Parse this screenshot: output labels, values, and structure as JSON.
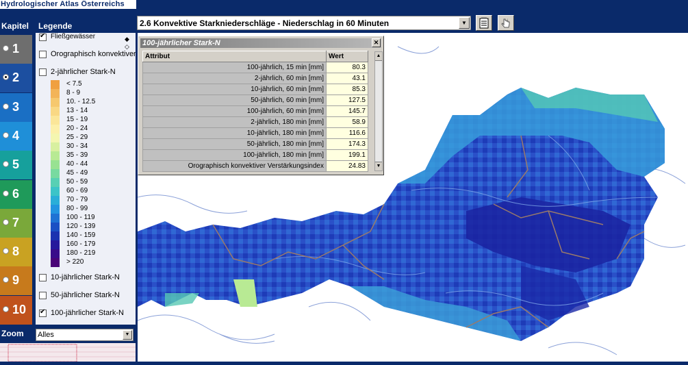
{
  "app": {
    "title": "Hydrologischer Atlas Österreichs"
  },
  "toolbar": {
    "map_select_value": "2.6 Konvektive Starkniederschläge - Niederschlag in 60 Minuten",
    "print_icon": "notepad-icon",
    "info_icon": "hand-pointer-icon"
  },
  "sidebar": {
    "kapitel_label": "Kapitel",
    "legende_label": "Legende",
    "chapters": [
      {
        "label": "1",
        "color": "#6e6e6e",
        "selected": false
      },
      {
        "label": "2",
        "color": "#1c4fa0",
        "selected": true
      },
      {
        "label": "3",
        "color": "#1a6fc4",
        "selected": false
      },
      {
        "label": "4",
        "color": "#1f8fd8",
        "selected": false
      },
      {
        "label": "5",
        "color": "#16a09c",
        "selected": false
      },
      {
        "label": "6",
        "color": "#1f9a5a",
        "selected": false
      },
      {
        "label": "7",
        "color": "#7aa83a",
        "selected": false
      },
      {
        "label": "8",
        "color": "#c9a222",
        "selected": false
      },
      {
        "label": "9",
        "color": "#c77a1c",
        "selected": false
      },
      {
        "label": "10",
        "color": "#c0521c",
        "selected": false
      }
    ]
  },
  "legend": {
    "layers": [
      {
        "label": "Fließgewässer",
        "checked": true
      },
      {
        "label": "Orographisch konvektiver",
        "checked": false
      },
      {
        "label": "2-jährlicher Stark-N",
        "checked": false
      }
    ],
    "classes": [
      {
        "label": "< 7.5",
        "color": "#f0a040"
      },
      {
        "label": "8 - 9",
        "color": "#f3b458"
      },
      {
        "label": "10. - 12.5",
        "color": "#f6c86e"
      },
      {
        "label": "13 - 14",
        "color": "#f9d884"
      },
      {
        "label": "15 - 19",
        "color": "#fbe699"
      },
      {
        "label": "20 - 24",
        "color": "#fcf0aa"
      },
      {
        "label": "25 - 29",
        "color": "#f4f6b0"
      },
      {
        "label": "30 - 34",
        "color": "#d8f0a0"
      },
      {
        "label": "35 - 39",
        "color": "#b8ea94"
      },
      {
        "label": "40 - 44",
        "color": "#98e292"
      },
      {
        "label": "45 - 49",
        "color": "#78daa0"
      },
      {
        "label": "50 - 59",
        "color": "#58d0b4"
      },
      {
        "label": "60 - 69",
        "color": "#3cc4c8"
      },
      {
        "label": "70 - 79",
        "color": "#2aaed8"
      },
      {
        "label": "80 - 99",
        "color": "#2294e0"
      },
      {
        "label": "100 - 119",
        "color": "#1e72d4"
      },
      {
        "label": "120 - 139",
        "color": "#1a50c4"
      },
      {
        "label": "140 - 159",
        "color": "#1a32b0"
      },
      {
        "label": "160 - 179",
        "color": "#26189c"
      },
      {
        "label": "180 - 219",
        "color": "#380c8a"
      },
      {
        "label": "> 220",
        "color": "#4a0478"
      }
    ],
    "more_layers": [
      {
        "label": "10-jährlicher Stark-N",
        "checked": false
      },
      {
        "label": "50-jährlicher Stark-N",
        "checked": false
      },
      {
        "label": "100-jährlicher Stark-N",
        "checked": true
      }
    ]
  },
  "zoom": {
    "label": "Zoom",
    "value": "Alles"
  },
  "popup": {
    "title": "100-jährlicher Stark-N",
    "col_attr": "Attribut",
    "col_value": "Wert",
    "rows": [
      {
        "attr": "100-jährlich, 15 min [mm]",
        "value": "80.3"
      },
      {
        "attr": "2-jährlich, 60 min [mm]",
        "value": "43.1"
      },
      {
        "attr": "10-jährlich, 60 min [mm]",
        "value": "85.3"
      },
      {
        "attr": "50-jährlich, 60 min [mm]",
        "value": "127.5"
      },
      {
        "attr": "100-jährlich, 60 min [mm]",
        "value": "145.7"
      },
      {
        "attr": "2-jährlich, 180 min [mm]",
        "value": "58.9"
      },
      {
        "attr": "10-jährlich, 180 min [mm]",
        "value": "116.6"
      },
      {
        "attr": "50-jährlich, 180 min [mm]",
        "value": "174.3"
      },
      {
        "attr": "100-jährlich, 180 min [mm]",
        "value": "199.1"
      },
      {
        "attr": "Orographisch konvektiver Verstärkungsindex",
        "value": "24.83"
      }
    ]
  }
}
